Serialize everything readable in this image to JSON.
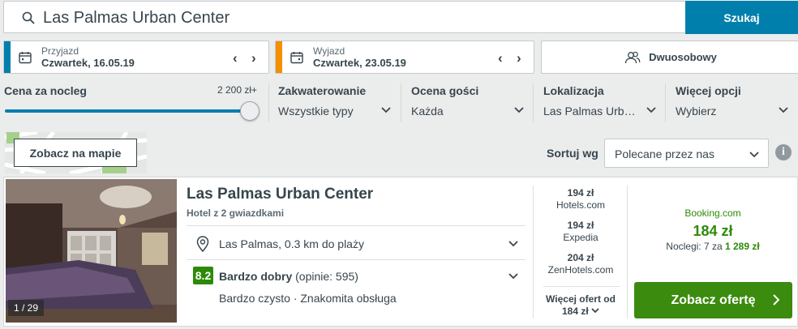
{
  "search": {
    "value": "Las Palmas Urban Center",
    "button": "Szukaj"
  },
  "checkin": {
    "label": "Przyjazd",
    "value": "Czwartek, 16.05.19",
    "color": "#007fad"
  },
  "checkout": {
    "label": "Wyjazd",
    "value": "Czwartek, 23.05.19",
    "color": "#f48f00"
  },
  "guests": {
    "value": "Dwuosobowy"
  },
  "filters": {
    "price": {
      "label": "Cena za nocleg",
      "max": "2 200 zł+",
      "fill_percent": 100
    },
    "accommodation": {
      "label": "Zakwaterowanie",
      "value": "Wszystkie typy"
    },
    "rating": {
      "label": "Ocena gości",
      "value": "Każda"
    },
    "location": {
      "label": "Lokalizacja",
      "value": "Las Palmas Urb…"
    },
    "more": {
      "label": "Więcej opcji",
      "value": "Wybierz"
    }
  },
  "map": {
    "button": "Zobacz na mapie"
  },
  "sort": {
    "label": "Sortuj wg",
    "value": "Polecane przez nas"
  },
  "hotel": {
    "name": "Las Palmas Urban Center",
    "type": "Hotel z 2 gwiazdkami",
    "photo_counter": "1 / 29",
    "location": "Las Palmas, 0.3 km do plaży",
    "rating_score": "8.2",
    "rating_label": "Bardzo dobry",
    "rating_reviews": "(opinie: 595)",
    "highlights": "Bardzo czysto · Znakomita obsługa"
  },
  "alt_offers": [
    {
      "price": "194 zł",
      "provider": "Hotels.com"
    },
    {
      "price": "194 zł",
      "provider": "Expedia"
    },
    {
      "price": "204 zł",
      "provider": "ZenHotels.com"
    }
  ],
  "more_offers": {
    "line1": "Więcej ofert od",
    "line2": "184 zł"
  },
  "best_offer": {
    "provider": "Booking.com",
    "price": "184 zł",
    "nights_prefix": "Noclegi: 7 za",
    "nights_total": "1 289 zł",
    "button": "Zobacz ofertę"
  }
}
